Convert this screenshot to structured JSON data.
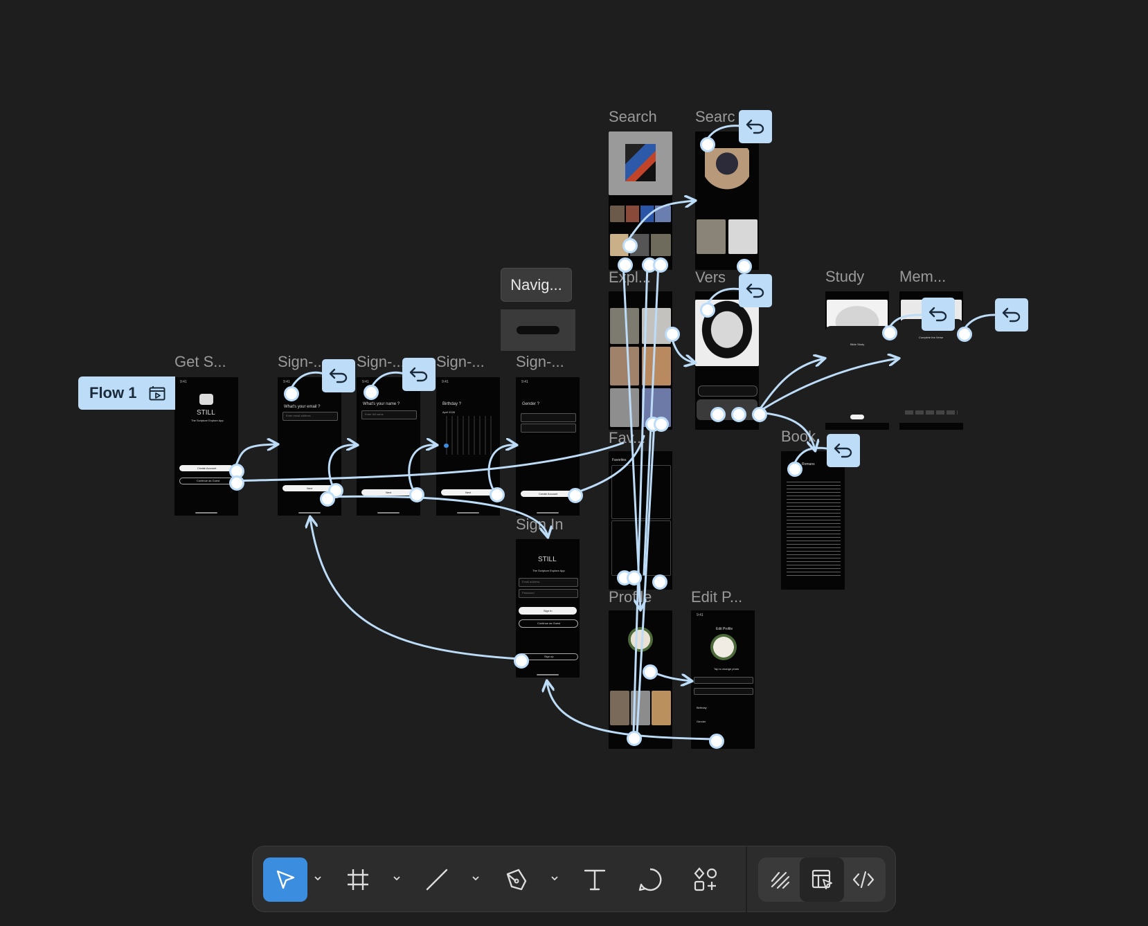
{
  "flow": {
    "label": "Flow 1",
    "icon": "play-frame-icon"
  },
  "frames": {
    "get_started": "Get S...",
    "signup_email": "Sign-...",
    "signup_name": "Sign-...",
    "signup_birthday": "Sign-...",
    "signup_gender": "Sign-...",
    "sign_in": "Sign In",
    "search": "Search",
    "search_result": "Searc",
    "explore": "Expl...",
    "verse": "Vers",
    "favorites": "Fav...",
    "profile": "Profile",
    "edit_profile": "Edit P...",
    "study": "Study",
    "memorize": "Mem...",
    "book": "Book",
    "navigation": "Navig..."
  },
  "screens": {
    "get_started": {
      "time": "9:41",
      "logo": "STILL",
      "tagline": "The Scripture Explore App",
      "create": "Create Account",
      "guest": "Continue as Guest"
    },
    "signup_email": {
      "time": "9:41",
      "question": "What's your email ?",
      "placeholder": "Enter email address",
      "next": "Next"
    },
    "signup_name": {
      "time": "9:41",
      "question": "What's your name ?",
      "placeholder": "Enter full name",
      "next": "Next"
    },
    "signup_birthday": {
      "time": "9:41",
      "question": "Birthday ?",
      "month": "April 2026",
      "next": "Next"
    },
    "signup_gender": {
      "time": "9:41",
      "question": "Gender ?",
      "create": "Create Account"
    },
    "sign_in": {
      "logo": "STILL",
      "tagline": "The Scripture Explore App",
      "email": "Email address",
      "password": "Password",
      "signin": "Sign In",
      "guest": "Continue as Guest",
      "signup": "Sign up"
    },
    "edit_profile": {
      "time": "9:41",
      "title": "Edit Profile",
      "hint": "Tap to change photo",
      "birthday": "Birthday",
      "gender": "Gender"
    },
    "study": {
      "title": "Bible Study"
    },
    "memorize": {
      "title": "Complete the Verse"
    },
    "book": {
      "book": "Romans"
    },
    "favorites": {
      "title": "Favorites"
    }
  },
  "toolbar": {
    "tools": [
      {
        "name": "move-tool",
        "icon": "cursor-arrow-icon",
        "active": true
      },
      {
        "name": "frame-tool",
        "icon": "frame-hash-icon"
      },
      {
        "name": "line-tool",
        "icon": "line-icon"
      },
      {
        "name": "pen-tool",
        "icon": "pen-nib-icon"
      },
      {
        "name": "text-tool",
        "icon": "text-t-icon"
      },
      {
        "name": "comment-tool",
        "icon": "comment-bubble-icon"
      },
      {
        "name": "components-tool",
        "icon": "shapes-plus-icon"
      }
    ],
    "modes": [
      {
        "name": "draw-mode",
        "icon": "scribble-icon"
      },
      {
        "name": "design-mode",
        "icon": "layout-cursor-icon",
        "active": true
      },
      {
        "name": "dev-mode",
        "icon": "code-brackets-icon"
      }
    ]
  },
  "colors": {
    "background": "#1e1e1e",
    "connector": "#bcdcf8",
    "accent": "#3b8de0"
  }
}
